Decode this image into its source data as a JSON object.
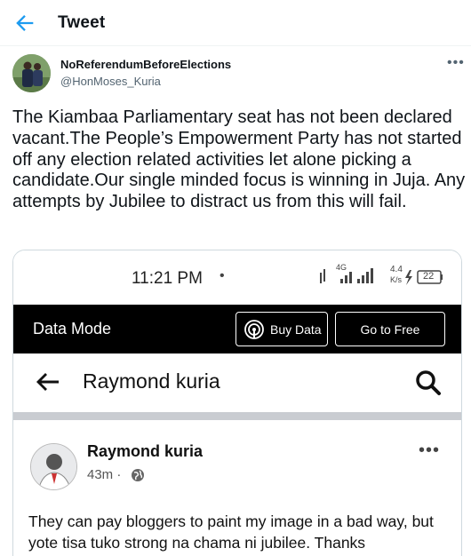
{
  "header": {
    "title": "Tweet",
    "back_icon": "arrow-left-icon"
  },
  "author": {
    "display_name": "NoReferendumBeforeElections",
    "handle": "@HonMoses_Kuria",
    "more_icon": "ellipsis-icon"
  },
  "tweet": {
    "text": "The Kiambaa Parliamentary seat has not been declared vacant.The People’s Empowerment Party has not started off any election related activities let alone picking a candidate.Our single minded focus is winning in Juja. Any attempts by Jubilee to distract us from this will fail."
  },
  "media": {
    "status_bar": {
      "time": "11:21 PM",
      "dot": "•",
      "network": "4G",
      "speed": "4.4",
      "speed_unit": "K/s",
      "battery": "22"
    },
    "data_mode": {
      "label": "Data Mode",
      "buy_data": "Buy Data",
      "go_free": "Go to Free"
    },
    "search": {
      "title": "Raymond kuria"
    },
    "post": {
      "author": "Raymond kuria",
      "time": "43m ·",
      "more": "•••",
      "text": "They can pay bloggers to paint my image in a bad way, but yote tisa tuko strong na chama ni jubilee. Thanks"
    }
  },
  "colors": {
    "accent": "#1d9bf0",
    "text": "#0f1419",
    "muted": "#536471",
    "border": "#cfd9de"
  }
}
